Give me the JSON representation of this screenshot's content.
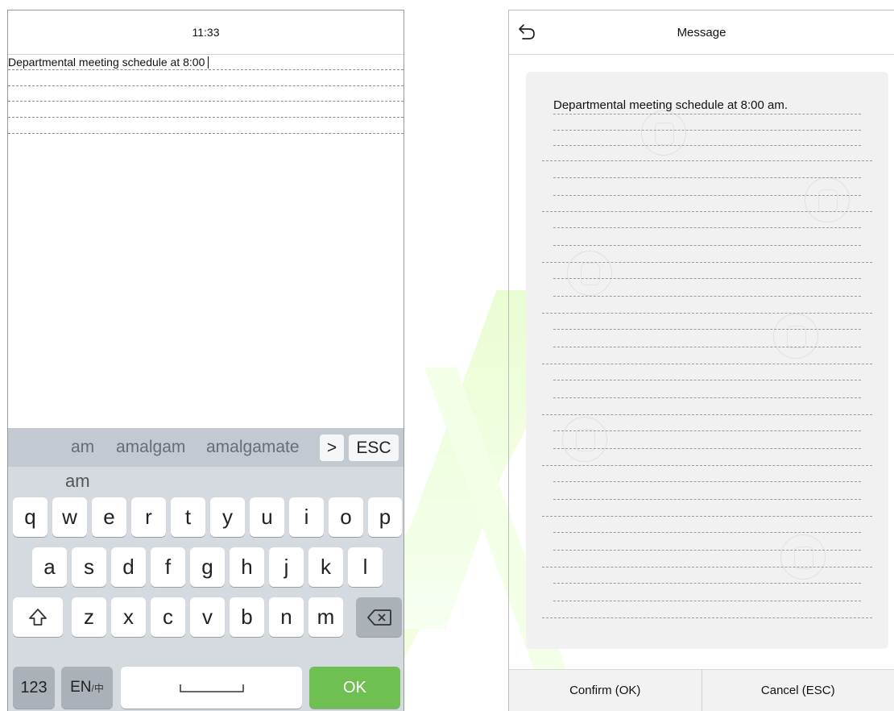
{
  "left": {
    "time": "11:33",
    "editor_text": "Departmental meeting schedule at 8:00",
    "suggestions": [
      "am",
      "amalgam",
      "amalgamate"
    ],
    "more_label": ">",
    "esc_label": "ESC",
    "preview": "am",
    "row1": [
      "q",
      "w",
      "e",
      "r",
      "t",
      "y",
      "u",
      "i",
      "o",
      "p"
    ],
    "row2": [
      "a",
      "s",
      "d",
      "f",
      "g",
      "h",
      "j",
      "k",
      "l"
    ],
    "row3": [
      "z",
      "x",
      "c",
      "v",
      "b",
      "n",
      "m"
    ],
    "shift_icon": "shift-arrow-icon",
    "backspace_icon": "backspace-icon",
    "num_label": "123",
    "lang_label": "EN",
    "lang_alt": "/中",
    "space_icon": "space-bar-icon",
    "ok_label": "OK"
  },
  "right": {
    "title": "Message",
    "back_icon": "back-arrow-icon",
    "message_text": "Departmental meeting schedule at 8:00 am.",
    "confirm_label": "Confirm (OK)",
    "cancel_label": "Cancel (ESC)"
  },
  "colors": {
    "ok_key": "#6fbf52",
    "keyboard_bg": "#d5dae0",
    "suggestion_bar": "#c3c9d1",
    "card_bg": "#f1f1f1"
  }
}
